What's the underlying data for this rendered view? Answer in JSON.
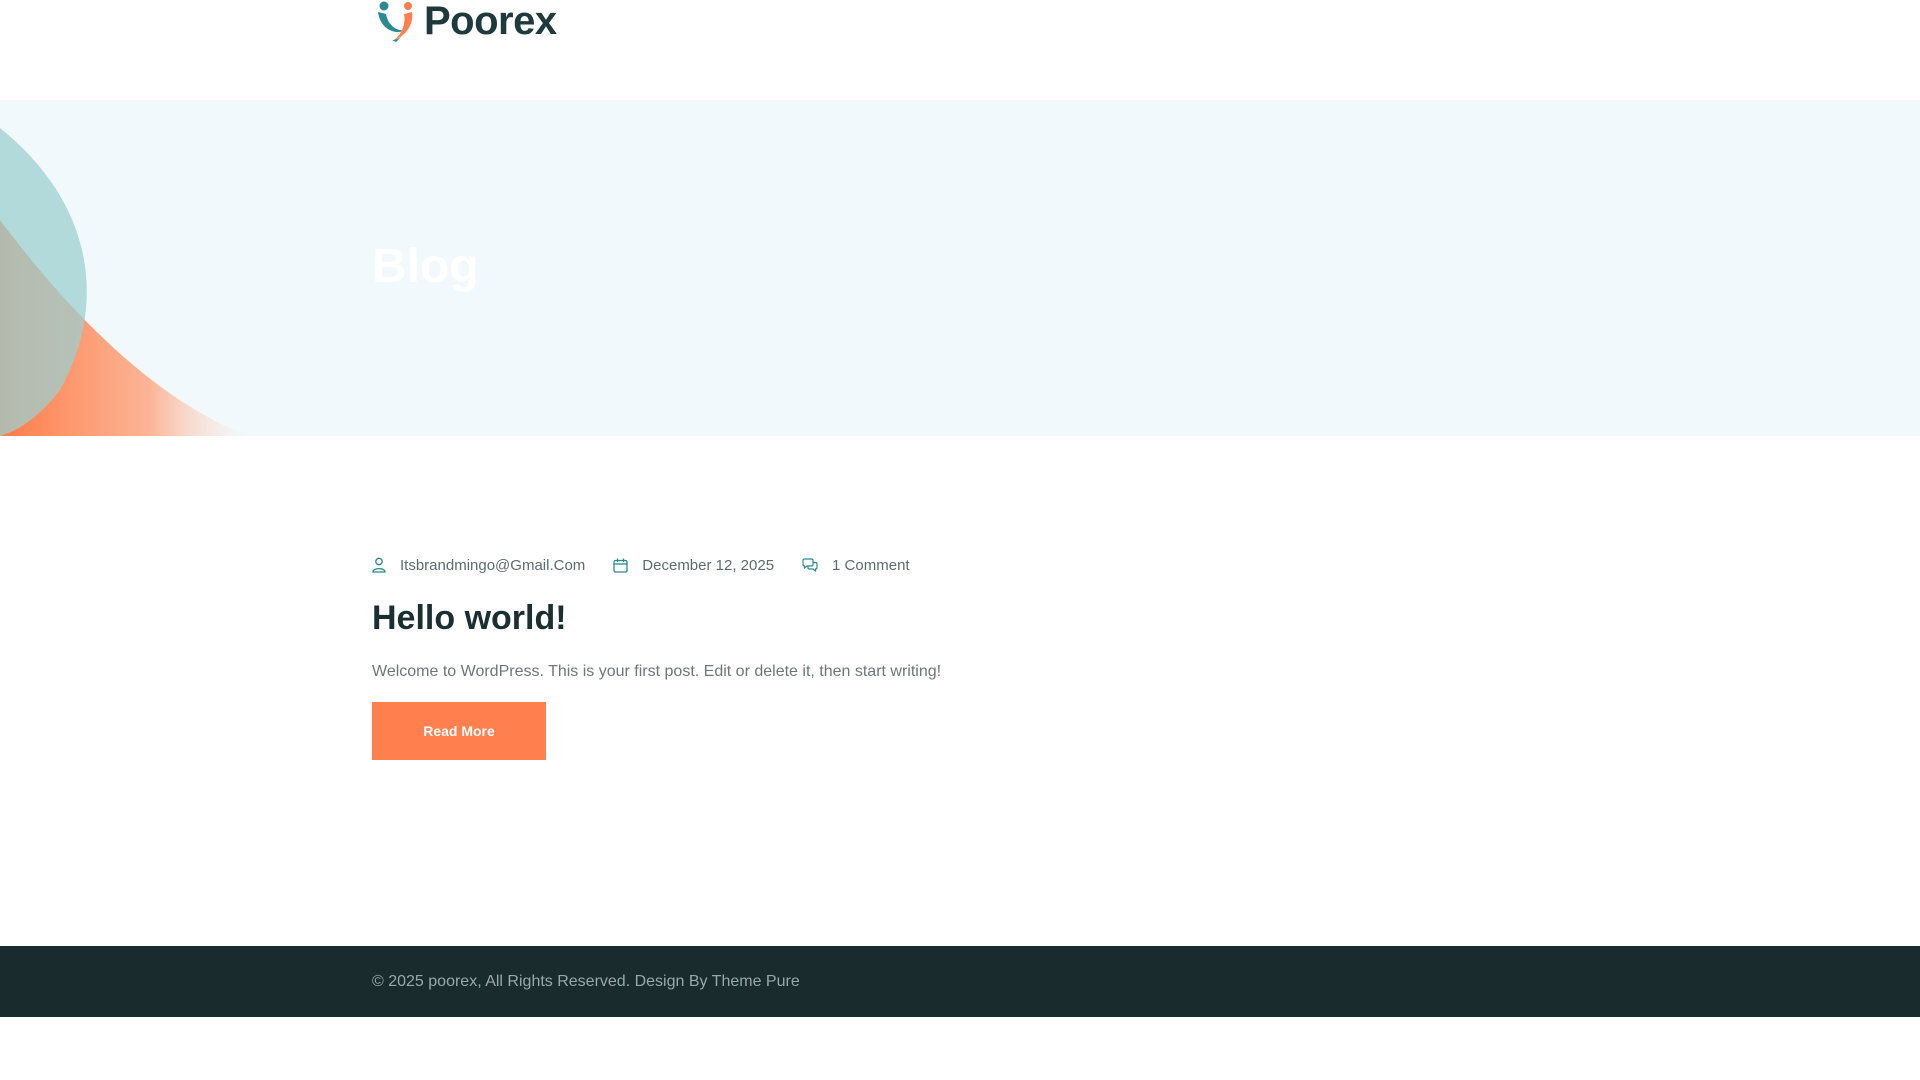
{
  "header": {
    "logo_text": "Poorex",
    "logo_icon": "poorex-logo-icon"
  },
  "hero": {
    "title": "Blog"
  },
  "post": {
    "author": "Itsbrandmingo@Gmail.Com",
    "date": "December 12, 2025",
    "comments": "1 Comment",
    "title": "Hello world!",
    "excerpt": "Welcome to WordPress. This is your first post. Edit or delete it, then start writing!",
    "read_more_label": "Read More",
    "icons": {
      "author": "user-icon",
      "date": "calendar-icon",
      "comments": "comment-icon"
    }
  },
  "footer": {
    "copyright": "© 2025 poorex, All Rights Reserved. Design By Theme Pure"
  },
  "colors": {
    "accent": "#ff7f4f",
    "teal": "#2a8a8f",
    "heading": "#1a2f31",
    "hero_bg": "#f2f9fc",
    "footer_bg": "#192b2d"
  }
}
